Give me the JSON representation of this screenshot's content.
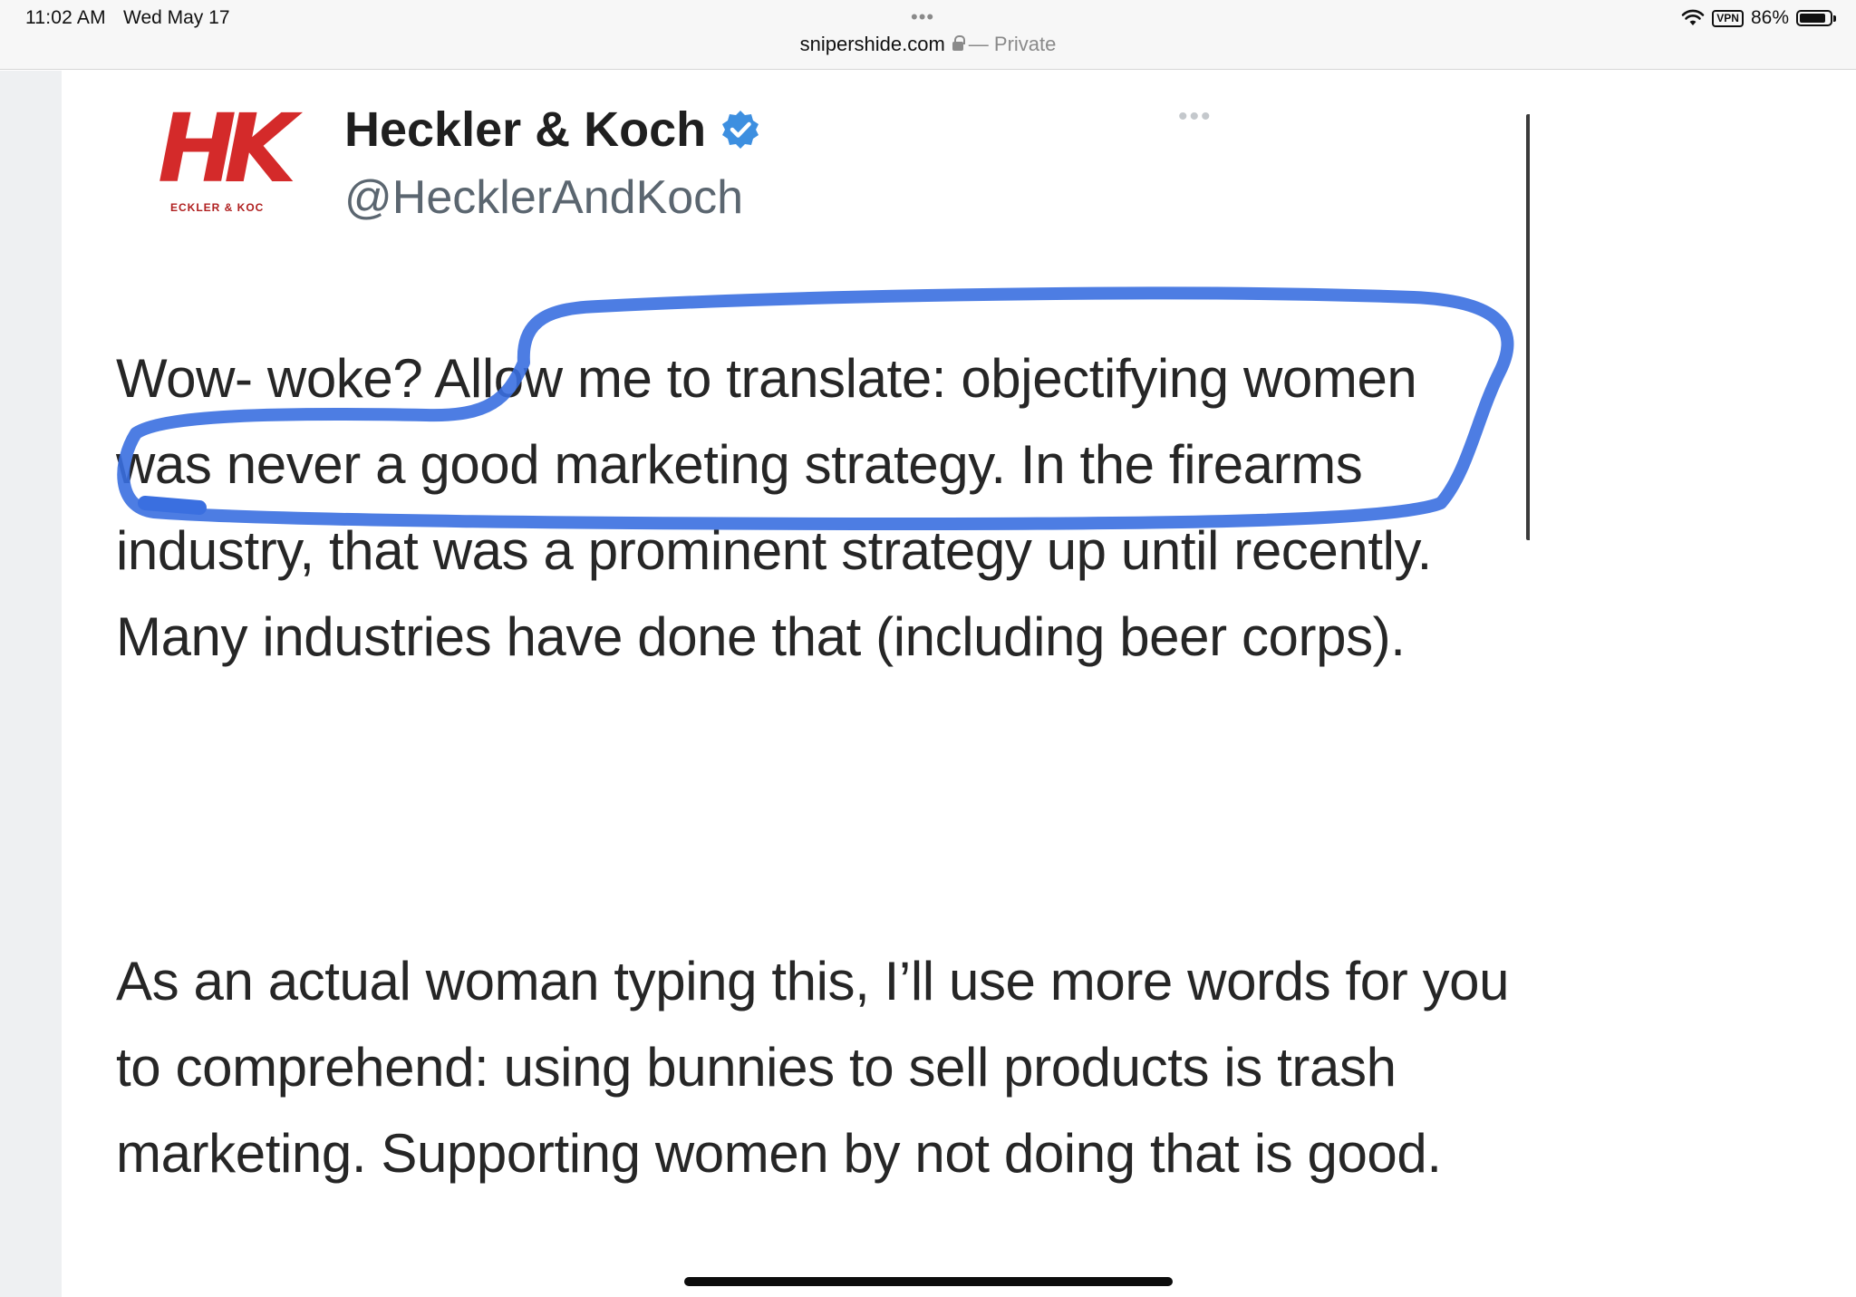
{
  "status_bar": {
    "time": "11:02 AM",
    "date": "Wed May 17",
    "dots": "•••",
    "url": "snipershide.com",
    "private_label": "— Private",
    "vpn": "VPN",
    "battery": "86%",
    "battery_level": 0.86
  },
  "tweet": {
    "account_name": "Heckler & Koch",
    "handle": "@HecklerAndKoch",
    "logo_text": "HK",
    "logo_subline": "ECKLER & KOC",
    "paragraph_1": "Wow- woke? Allow me to translate: objectifying women was never a good marketing strategy. In the firearms industry, that was a prominent strategy up until recently. Many industries have done that (including beer corps).",
    "paragraph_2": "As an actual woman typing this, I’ll use more words for you to comprehend: using bunnies to sell products is trash marketing. Supporting women by not doing that is good.",
    "more": "•••"
  },
  "colors": {
    "hk_red": "#d42a2a",
    "verified_blue": "#3d8fe0",
    "annotation_blue": "#3a6fe0"
  }
}
